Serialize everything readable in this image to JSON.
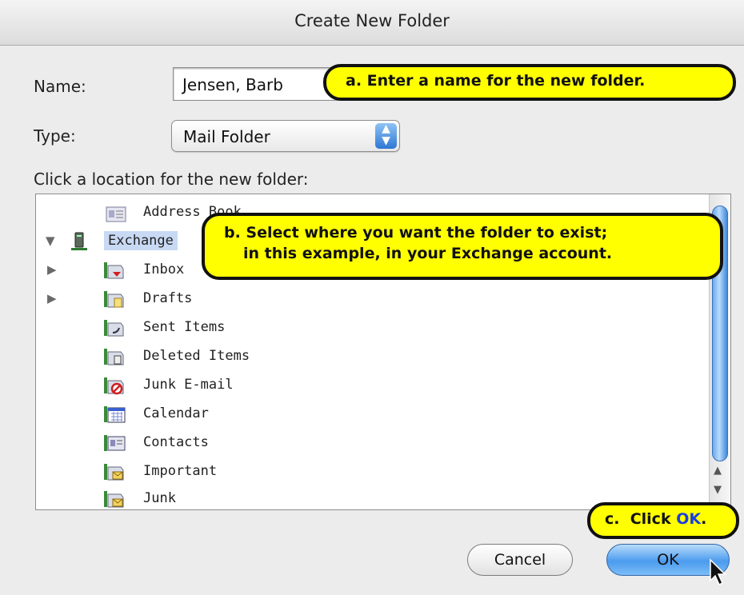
{
  "window": {
    "title": "Create New Folder"
  },
  "form": {
    "name_label": "Name:",
    "name_value": "Jensen, Barb",
    "type_label": "Type:",
    "type_value": "Mail Folder",
    "location_label": "Click a location for the new folder:"
  },
  "tree": {
    "items": [
      {
        "label": "Address Book",
        "icon": "address-book-icon"
      },
      {
        "label": "Exchange",
        "icon": "server-icon",
        "expanded": true,
        "selected": true
      },
      {
        "label": "Inbox",
        "icon": "inbox-folder-icon"
      },
      {
        "label": "Drafts",
        "icon": "drafts-folder-icon"
      },
      {
        "label": "Sent Items",
        "icon": "sent-folder-icon"
      },
      {
        "label": "Deleted Items",
        "icon": "deleted-folder-icon"
      },
      {
        "label": "Junk E-mail",
        "icon": "junk-folder-icon"
      },
      {
        "label": "Calendar",
        "icon": "calendar-folder-icon"
      },
      {
        "label": "Contacts",
        "icon": "contacts-folder-icon"
      },
      {
        "label": "Important",
        "icon": "mail-folder-icon"
      },
      {
        "label": "Junk",
        "icon": "mail-folder-icon"
      }
    ]
  },
  "buttons": {
    "cancel": "Cancel",
    "ok": "OK"
  },
  "callouts": {
    "a": "a.  Enter a name for the new folder.",
    "b_line1": "b.  Select where you want the folder to exist;",
    "b_line2": "in this example, in your Exchange account.",
    "c_prefix": "c.  Click ",
    "c_ok": "OK",
    "c_suffix": "."
  },
  "colors": {
    "callout_fill": "#ffff00",
    "selection": "#c8d9f4",
    "accent": "#3f88dc"
  }
}
